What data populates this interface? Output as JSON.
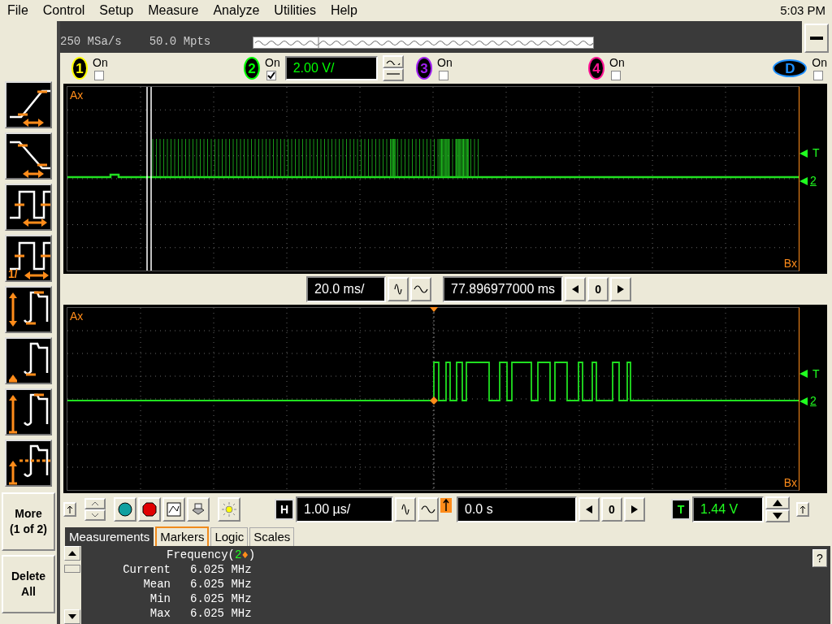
{
  "menu": [
    "File",
    "Control",
    "Setup",
    "Measure",
    "Analyze",
    "Utilities",
    "Help"
  ],
  "clock": "5:03 PM",
  "acquisition": {
    "sample_rate": "250 MSa/s",
    "memory": "50.0 Mpts"
  },
  "channels": [
    {
      "label": "1",
      "on_label": "On",
      "on": false,
      "color": "#ffff00"
    },
    {
      "label": "2",
      "on_label": "On",
      "on": true,
      "color": "#00ff00",
      "scale": "2.00 V/"
    },
    {
      "label": "3",
      "on_label": "On",
      "on": false,
      "color": "#a020f0"
    },
    {
      "label": "4",
      "on_label": "On",
      "on": false,
      "color": "#ff1493"
    },
    {
      "label": "D",
      "on_label": "On",
      "on": false,
      "color": "#1e90ff"
    }
  ],
  "tools": [
    {
      "kind": "rise"
    },
    {
      "kind": "fall"
    },
    {
      "kind": "period"
    },
    {
      "kind": "frequency",
      "label": "1/"
    },
    {
      "kind": "vpp"
    },
    {
      "kind": "vbase"
    },
    {
      "kind": "vmax"
    },
    {
      "kind": "vavg"
    }
  ],
  "side_buttons": [
    {
      "lines": [
        "More",
        "(1 of 2)"
      ]
    },
    {
      "lines": [
        "Delete",
        "All"
      ]
    }
  ],
  "main_plot": {
    "marker_a": "Ax",
    "marker_b": "Bx",
    "trigger_label": "T",
    "ground_label": "2"
  },
  "main_timebase": {
    "scale": "20.0 ms/",
    "delay": "77.896977000 ms",
    "step": "0"
  },
  "zoom_plot": {
    "marker_a": "Ax",
    "marker_b": "Bx",
    "trigger_label": "T",
    "ground_label": "2"
  },
  "zoom_controls": {
    "h_label": "H",
    "scale": "1.00 µs/",
    "delay": "0.0 s",
    "step": "0",
    "t_label": "T",
    "trigger_level": "1.44 V"
  },
  "tabs": [
    {
      "label": "Measurements",
      "selected": true,
      "focused": false
    },
    {
      "label": "Markers",
      "selected": false,
      "focused": true
    },
    {
      "label": "Logic",
      "selected": false,
      "focused": false
    },
    {
      "label": "Scales",
      "selected": false,
      "focused": false
    }
  ],
  "measurement": {
    "title_parts": [
      {
        "text": "Frequency(",
        "kind": "plain"
      },
      {
        "text": "2",
        "kind": "source"
      },
      {
        "text": "♦",
        "kind": "marker"
      },
      {
        "text": ")",
        "kind": "plain"
      }
    ],
    "rows": [
      {
        "label": "Current",
        "value": "6.025 MHz"
      },
      {
        "label": "Mean",
        "value": "6.025 MHz"
      },
      {
        "label": "Min",
        "value": "6.025 MHz"
      },
      {
        "label": "Max",
        "value": "6.025 MHz"
      }
    ],
    "help": "?"
  }
}
